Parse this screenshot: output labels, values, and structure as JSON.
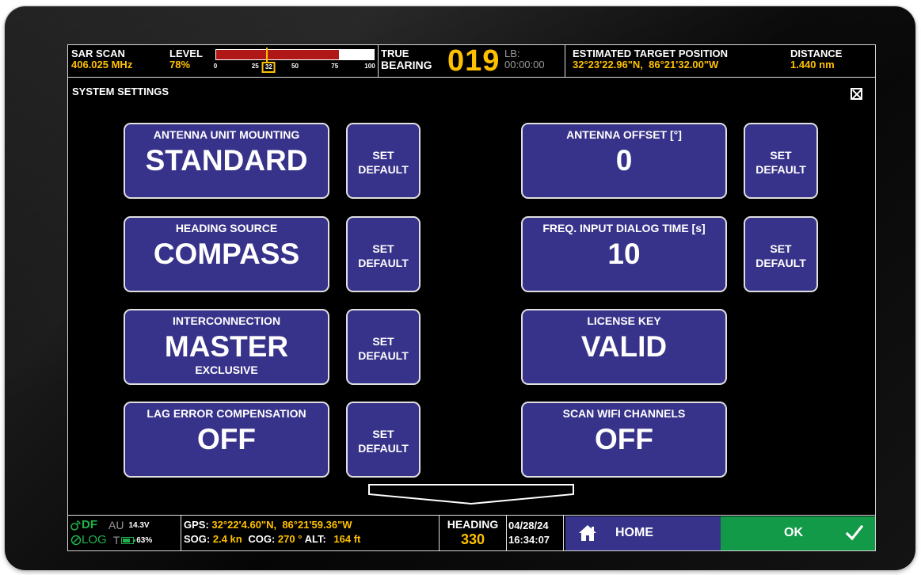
{
  "topbar": {
    "scan_label": "SAR SCAN",
    "scan_freq": "406.025 MHz",
    "level_label": "LEVEL",
    "level_value": "78%",
    "level_fraction": 0.78,
    "level_marker": 32,
    "level_ticks": [
      "0",
      "25",
      "32",
      "50",
      "75",
      "100"
    ],
    "bearing_label_1": "TRUE",
    "bearing_label_2": "BEARING",
    "bearing_value": "019",
    "lb_label": "LB:",
    "lb_time": "00:00:00",
    "target_label": "ESTIMATED TARGET POSITION",
    "target_value": "32°23'22.96\"N,  86°21'32.00\"W",
    "distance_label": "DISTANCE",
    "distance_value": "1.440 nm"
  },
  "page": {
    "title": "SYSTEM SETTINGS"
  },
  "settings": {
    "antenna_mounting": {
      "label": "ANTENNA UNIT MOUNTING",
      "value": "STANDARD"
    },
    "heading_source": {
      "label": "HEADING SOURCE",
      "value": "COMPASS"
    },
    "interconnection": {
      "label": "INTERCONNECTION",
      "value": "MASTER",
      "sub": "EXCLUSIVE"
    },
    "lag_error": {
      "label": "LAG ERROR COMPENSATION",
      "value": "OFF"
    },
    "antenna_offset": {
      "label": "ANTENNA OFFSET [°]",
      "value": "0"
    },
    "freq_dialog": {
      "label": "FREQ. INPUT DIALOG TIME [s]",
      "value": "10"
    },
    "license_key": {
      "label": "LICENSE KEY",
      "value": "VALID"
    },
    "scan_wifi": {
      "label": "SCAN WIFI CHANNELS",
      "value": "OFF"
    }
  },
  "set_default": {
    "line1": "SET",
    "line2": "DEFAULT"
  },
  "bottombar": {
    "df": "DF",
    "log": "LOG",
    "au": "AU",
    "voltage": "14.3V",
    "t": "T",
    "battery": "63%",
    "gps_label": "GPS:",
    "gps_value": "32°22'4.60\"N,  86°21'59.36\"W",
    "sog_label": "SOG:",
    "sog_value": "2.4 kn",
    "cog_label": "COG:",
    "cog_value": "270 °",
    "alt_label": "ALT:",
    "alt_value": "164 ft",
    "heading_label": "HEADING",
    "heading_value": "330",
    "date": "04/28/24",
    "time": "16:34:07",
    "home_label": "HOME",
    "ok_label": "OK"
  },
  "colors": {
    "tile": "#38338a",
    "accent_yellow": "#ffc000",
    "ok_green": "#129a49",
    "status_green": "#1fb24c",
    "level_red": "#b01818"
  },
  "icons": [
    "close-icon",
    "scroll-down-chevron-icon",
    "satellite-icon",
    "log-icon",
    "battery-icon",
    "home-icon",
    "checkmark-icon"
  ]
}
